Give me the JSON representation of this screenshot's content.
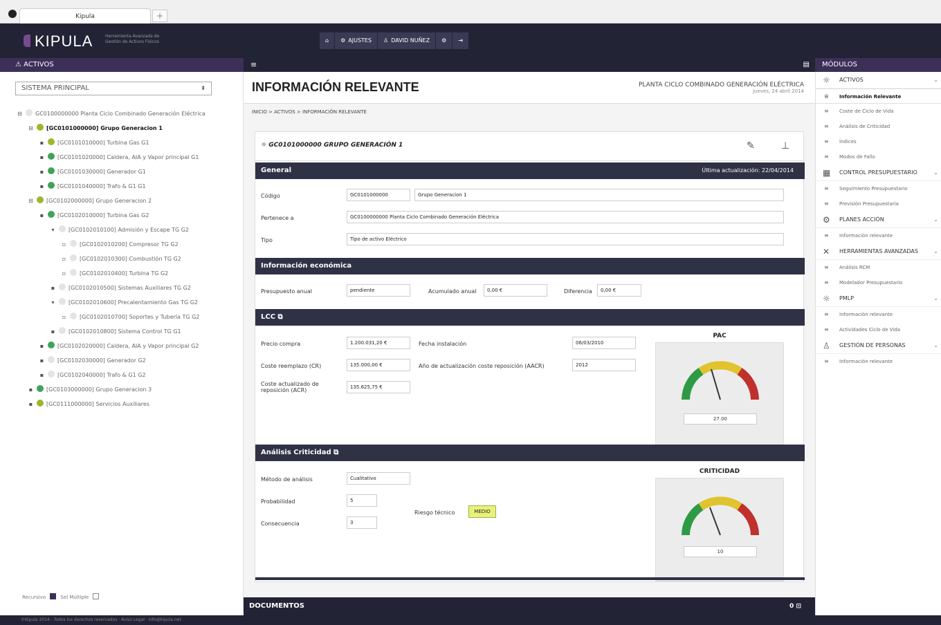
{
  "browser": {
    "tab_title": "Kipula",
    "new_tab": "+"
  },
  "header": {
    "logo": "KIPULA",
    "tagline": "Herramienta Avanzada de Gestión de Activos Físicos",
    "nav": [
      {
        "icon": "home-icon",
        "glyph": "⌂",
        "label": ""
      },
      {
        "icon": "gear-icon",
        "glyph": "⚙",
        "label": "AJUSTES"
      },
      {
        "icon": "user-icon",
        "glyph": "♙",
        "label": "DAVID NUÑEZ"
      },
      {
        "icon": "settings-icon",
        "glyph": "⚙",
        "label": ""
      },
      {
        "icon": "logout-icon",
        "glyph": "⇥",
        "label": ""
      }
    ]
  },
  "left": {
    "strip_title": "ACTIVOS",
    "system_select": "SISTEMA PRINCIPAL",
    "tree": [
      {
        "toggle": "⊟",
        "level": 0,
        "label": "GC0100000000 Planta Ciclo Combinado Generación Eléctrica",
        "color": "",
        "bold": false
      },
      {
        "toggle": "⊟",
        "level": 1,
        "label": "[GC0101000000] Grupo Generacion 1",
        "color": "#9bb82a",
        "bold": true
      },
      {
        "toggle": "▪",
        "level": 2,
        "label": "[GC0101010000] Turbina Gas G1",
        "color": "#9bb82a",
        "bold": false
      },
      {
        "toggle": "▪",
        "level": 2,
        "label": "[GC0101020000] Caldera, AIA y Vapor principal G1",
        "color": "#3fa35a",
        "bold": false
      },
      {
        "toggle": "▪",
        "level": 2,
        "label": "[GC0101030000] Generador G1",
        "color": "#3fa35a",
        "bold": false
      },
      {
        "toggle": "▪",
        "level": 2,
        "label": "[GC0101040000] Trafo & G1 G1",
        "color": "#3fa35a",
        "bold": false
      },
      {
        "toggle": "⊟",
        "level": 1,
        "label": "[GC0102000000] Grupo Generacion 2",
        "color": "#9bb82a",
        "bold": false
      },
      {
        "toggle": "▪",
        "level": 2,
        "label": "[GC0102010000] Turbina Gas G2",
        "color": "#3fa35a",
        "bold": false
      },
      {
        "toggle": "▾",
        "level": 3,
        "label": "[GC0102010100] Admisión y Escape TG G2",
        "color": "",
        "bold": false
      },
      {
        "toggle": "▫",
        "level": 4,
        "label": "[GC0102010200] Compresor TG G2",
        "color": "",
        "bold": false
      },
      {
        "toggle": "▫",
        "level": 4,
        "label": "[GC0102010300] Combustión TG G2",
        "color": "",
        "bold": false
      },
      {
        "toggle": "▫",
        "level": 4,
        "label": "[GC0102010400] Turbina TG G2",
        "color": "",
        "bold": false
      },
      {
        "toggle": "▪",
        "level": 3,
        "label": "[GC0102010500] Sistemas Auxiliares TG G2",
        "color": "",
        "bold": false
      },
      {
        "toggle": "▾",
        "level": 3,
        "label": "[GC0102010600] Precalentamiento Gas TG G2",
        "color": "",
        "bold": false
      },
      {
        "toggle": "▫",
        "level": 4,
        "label": "[GC0102010700] Soportes y Tubería TG G2",
        "color": "",
        "bold": false
      },
      {
        "toggle": "▪",
        "level": 3,
        "label": "[GC0102010800] Sistema Control TG G1",
        "color": "",
        "bold": false
      },
      {
        "toggle": "▪",
        "level": 2,
        "label": "[GC0102020000] Caldera, AIA y Vapor principal G2",
        "color": "#3fa35a",
        "bold": false
      },
      {
        "toggle": "▪",
        "level": 2,
        "label": "[GC0102030000] Generador G2",
        "color": "",
        "bold": false
      },
      {
        "toggle": "▪",
        "level": 2,
        "label": "[GC0102040000] Trafo & G1 G2",
        "color": "",
        "bold": false
      },
      {
        "toggle": "▪",
        "level": 1,
        "label": "[GC0103000000] Grupo Generacion 3",
        "color": "#3fa35a",
        "bold": false
      },
      {
        "toggle": "▪",
        "level": 1,
        "label": "[GC0111000000] Servicios Auxiliares",
        "color": "#9bb82a",
        "bold": false
      }
    ],
    "footer_recursive": "Recursivo",
    "footer_multi": "Sel Múltiple"
  },
  "main": {
    "page_title": "INFORMACIÓN RELEVANTE",
    "page_subtitle": "PLANTA CICLO COMBINADO GENERACIÓN ELÉCTRICA",
    "page_date": "Jueves, 24 abril 2014",
    "breadcrumb": "INICIO > ACTIVOS > INFORMACIÓN RELEVANTE",
    "card_title": "GC0101000000 GRUPO GENERACIÓN 1",
    "general": {
      "title": "General",
      "updated": "Última actualización: 22/04/2014",
      "codigo_label": "Código",
      "codigo": "GC0101000000",
      "nombre": "Grupo Generacion 1",
      "pertenece_label": "Pertenece a",
      "pertenece": "GC0100000000 Planta Ciclo Combinado Generación Eléctrica",
      "tipo_label": "Tipo",
      "tipo": "Tipo de activo Eléctrico"
    },
    "economica": {
      "title": "Información económica",
      "presupuesto_label": "Presupuesto anual",
      "presupuesto": "pendiente",
      "acumulado_label": "Acumulado anual",
      "acumulado": "0,00 €",
      "diferencia_label": "Diferencia",
      "diferencia": "0,00 €"
    },
    "lcc": {
      "title": "LCC",
      "precio_label": "Precio compra",
      "precio": "1.200.031,20 €",
      "fecha_label": "Fecha instalación",
      "fecha": "06/03/2010",
      "coste_label": "Coste reemplazo (CR)",
      "coste": "135.000,00 €",
      "anio_label": "Año de actualización coste reposición (AACR)",
      "anio": "2012",
      "acr_label": "Coste actualizado de reposición (ACR)",
      "acr": "135.625,75 €",
      "gauge_title": "PAC",
      "gauge_value": "27.00"
    },
    "criticidad": {
      "title": "Análisis Criticidad",
      "metodo_label": "Método de análisis",
      "metodo": "Cualitativo",
      "prob_label": "Probabilidad",
      "prob": "5",
      "cons_label": "Consecuencia",
      "cons": "3",
      "riesgo_label": "Riesgo técnico",
      "riesgo": "MEDIO",
      "gauge_title": "CRITICIDAD",
      "gauge_value": "10"
    },
    "docs_title": "DOCUMENTOS",
    "docs_count": "0"
  },
  "right": {
    "strip_title": "MÓDULOS",
    "modules": [
      {
        "title": "ACTIVOS",
        "icon": "sun-icon",
        "glyph": "☼",
        "items": [
          "Información Relevante",
          "Coste de Ciclo de Vida",
          "Análisis de Criticidad",
          "Índices",
          "Modos de Fallo"
        ]
      },
      {
        "title": "CONTROL PRESUPUESTARIO",
        "icon": "calendar-icon",
        "glyph": "▦",
        "items": [
          "Seguimiento Presupuestario",
          "Previsión Presupuestaria"
        ]
      },
      {
        "title": "PLANES ACCIÓN",
        "icon": "gear-icon",
        "glyph": "⚙",
        "items": [
          "Información relevante"
        ]
      },
      {
        "title": "HERRAMIENTAS AVANZADAS",
        "icon": "tools-icon",
        "glyph": "✕",
        "items": [
          "Análisis RCM",
          "Modelador Presupuestario"
        ]
      },
      {
        "title": "PMLP",
        "icon": "sun-icon",
        "glyph": "☼",
        "items": [
          "Información relevante",
          "Actividades Ciclo de Vida"
        ]
      },
      {
        "title": "GESTIÓN DE PERSONAS",
        "icon": "people-icon",
        "glyph": "♙",
        "items": [
          "Información relevante"
        ]
      }
    ]
  },
  "footer": {
    "text": "©Kipula 2014 - Todos los derechos reservados  ·  Aviso Legal  ·  info@kipula.net"
  },
  "colors": {
    "header": "#232336",
    "accent": "#3c2f58",
    "section": "#2f3145",
    "risk": "#e8f27a"
  }
}
